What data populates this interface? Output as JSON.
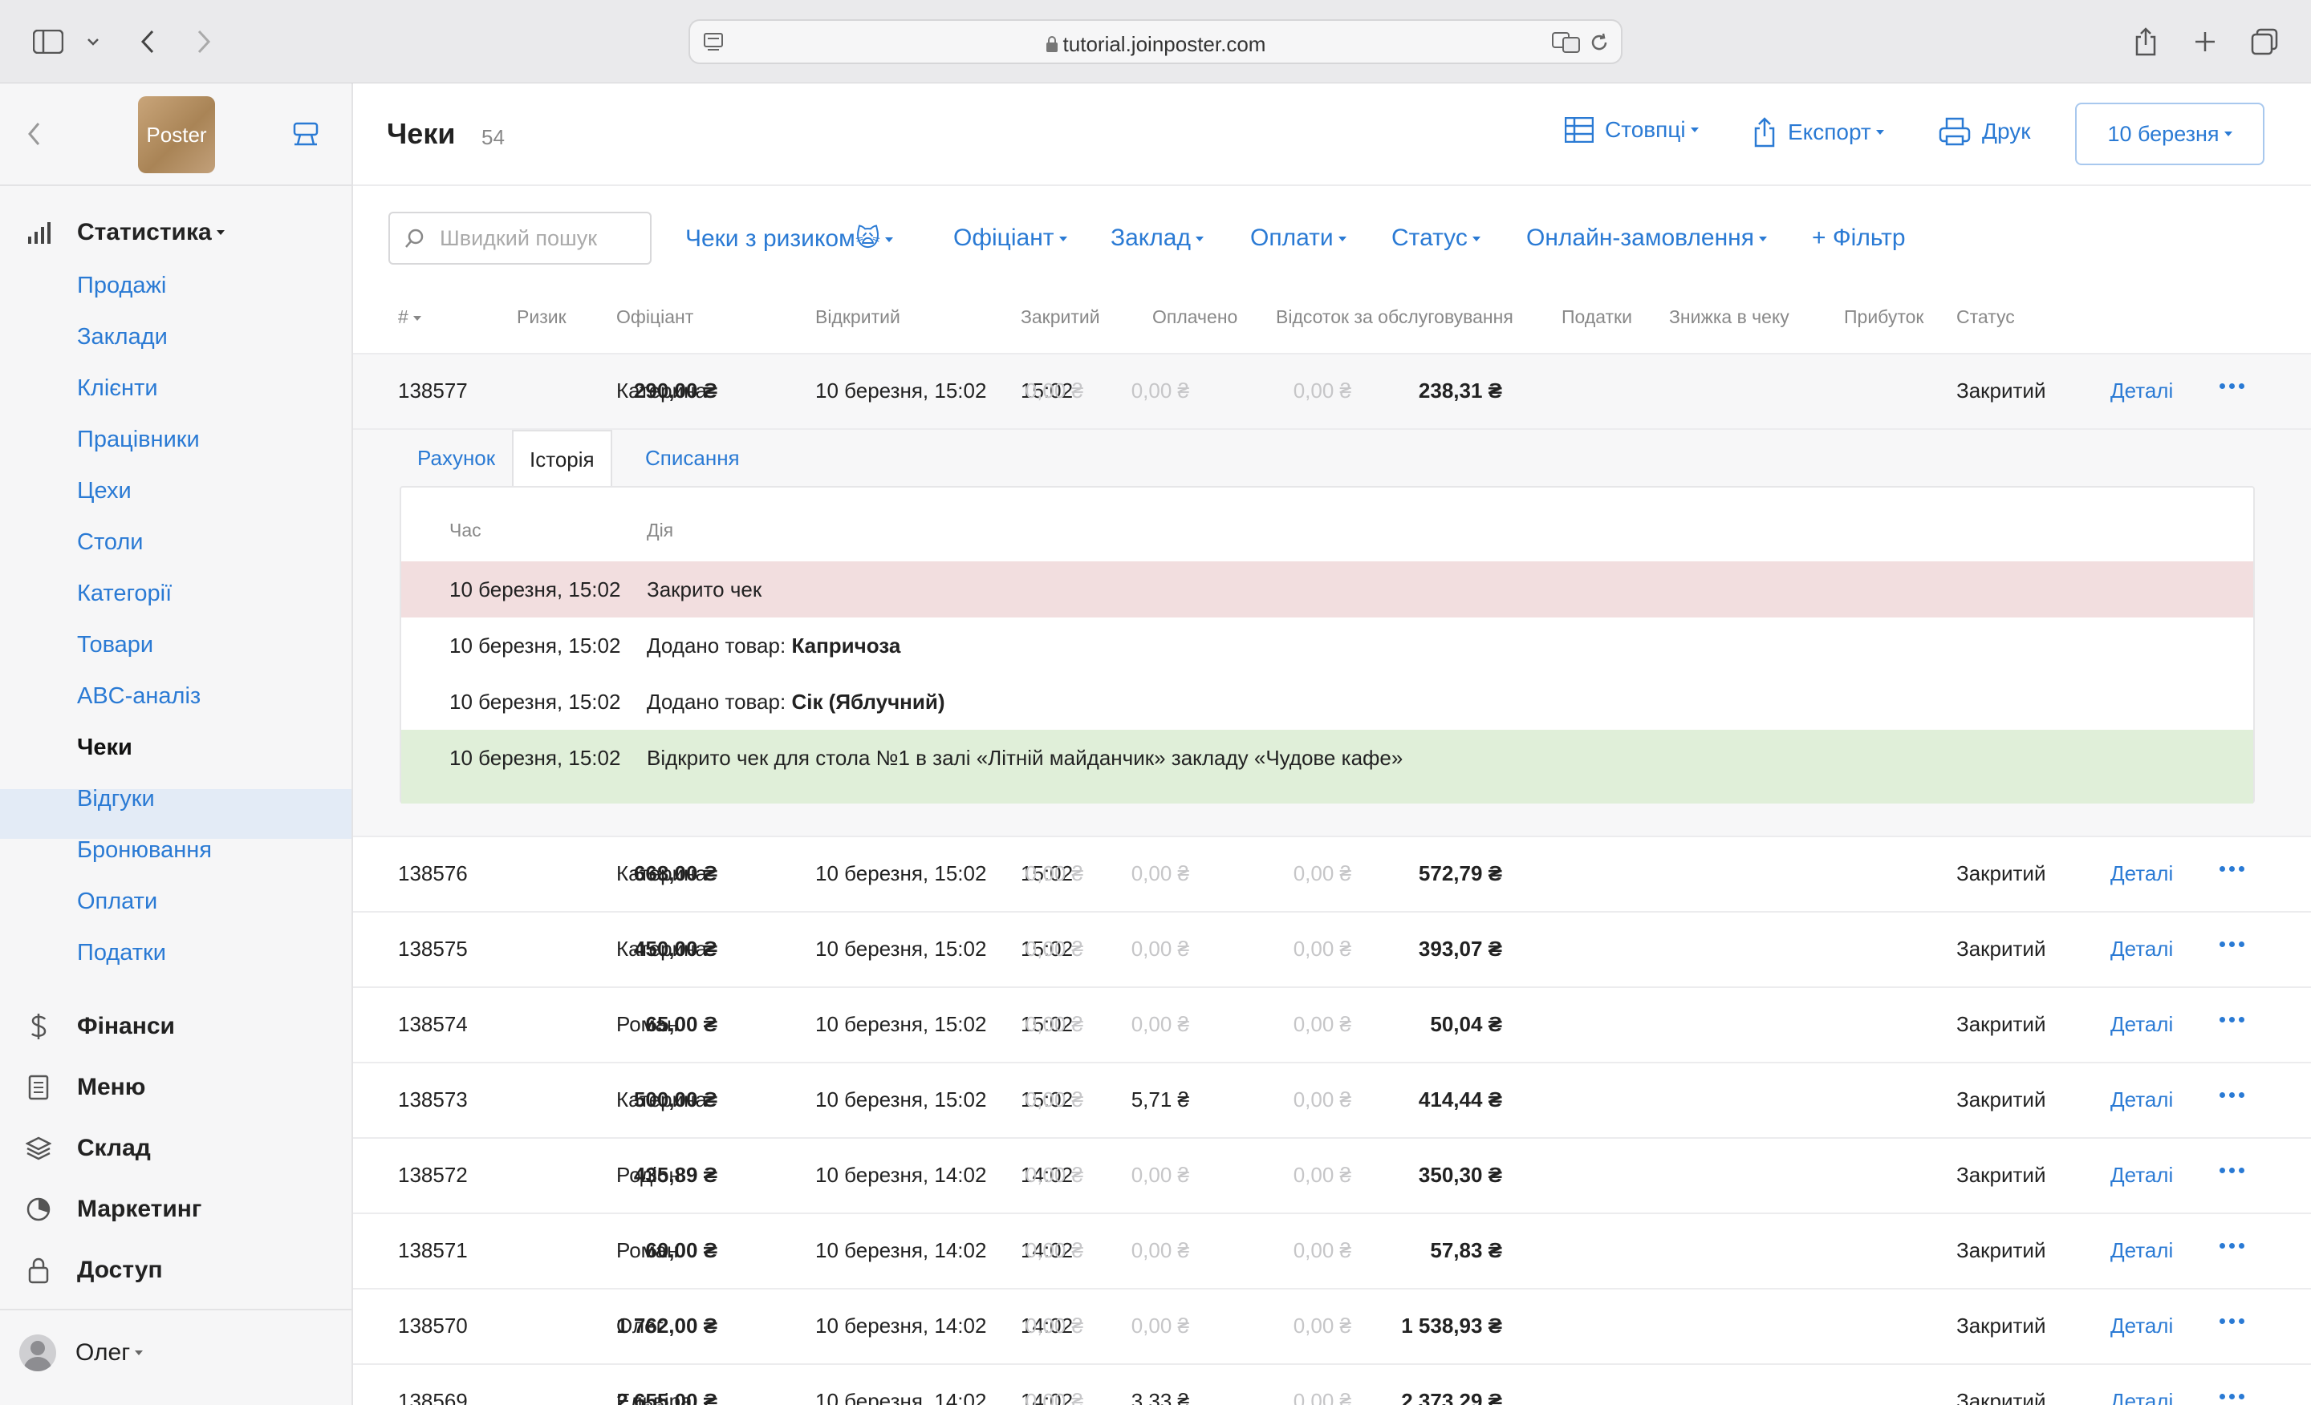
{
  "browser": {
    "url": "tutorial.joinposter.com"
  },
  "sidebar": {
    "logo_text": "Poster",
    "statistics_label": "Статистика",
    "items": [
      {
        "label": "Продажі"
      },
      {
        "label": "Заклади"
      },
      {
        "label": "Клієнти"
      },
      {
        "label": "Працівники"
      },
      {
        "label": "Цехи"
      },
      {
        "label": "Столи"
      },
      {
        "label": "Категорії"
      },
      {
        "label": "Товари"
      },
      {
        "label": "ABC-аналіз"
      },
      {
        "label": "Чеки"
      },
      {
        "label": "Відгуки"
      },
      {
        "label": "Бронювання"
      },
      {
        "label": "Оплати"
      },
      {
        "label": "Податки"
      }
    ],
    "active_item": "Чеки",
    "sections": [
      {
        "label": "Фінанси"
      },
      {
        "label": "Меню"
      },
      {
        "label": "Склад"
      },
      {
        "label": "Маркетинг"
      },
      {
        "label": "Доступ"
      }
    ],
    "user_name": "Олег"
  },
  "header": {
    "title": "Чеки",
    "count": "54",
    "columns_button": "Стовпці",
    "export_button": "Експорт",
    "print_button": "Друк",
    "date_button": "10 березня"
  },
  "filters": {
    "search_placeholder": "Швидкий пошук",
    "risk": "Чеки з ризиком",
    "risk_emoji": "🙀",
    "waiter": "Офіціант",
    "venue": "Заклад",
    "payments": "Оплати",
    "status": "Статус",
    "online": "Онлайн-замовлення",
    "add_filter": "+ Фільтр"
  },
  "table": {
    "headers": {
      "num": "#",
      "risk": "Ризик",
      "waiter": "Офіціант",
      "opened": "Відкритий",
      "closed": "Закритий",
      "paid": "Оплачено",
      "service": "Відсоток за обслуговування",
      "taxes": "Податки",
      "discount": "Знижка в чеку",
      "profit": "Прибуток",
      "status": "Статус"
    },
    "details_label": "Деталі",
    "rows": [
      {
        "id": "138577",
        "waiter": "Катерина",
        "opened": "10 березня, 15:02",
        "closed": "15:02",
        "paid": "290,00 ₴",
        "service": "0,00 ₴",
        "taxes": "0,00 ₴",
        "discount": "0,00 ₴",
        "profit": "238,31 ₴",
        "status": "Закритий"
      },
      {
        "id": "138576",
        "waiter": "Катерина",
        "opened": "10 березня, 15:02",
        "closed": "15:02",
        "paid": "668,00 ₴",
        "service": "0,00 ₴",
        "taxes": "0,00 ₴",
        "discount": "0,00 ₴",
        "profit": "572,79 ₴",
        "status": "Закритий"
      },
      {
        "id": "138575",
        "waiter": "Катерина",
        "opened": "10 березня, 15:02",
        "closed": "15:02",
        "paid": "450,00 ₴",
        "service": "0,00 ₴",
        "taxes": "0,00 ₴",
        "discount": "0,00 ₴",
        "profit": "393,07 ₴",
        "status": "Закритий"
      },
      {
        "id": "138574",
        "waiter": "Роман",
        "opened": "10 березня, 15:02",
        "closed": "15:02",
        "paid": "65,00 ₴",
        "service": "0,00 ₴",
        "taxes": "0,00 ₴",
        "discount": "0,00 ₴",
        "profit": "50,04 ₴",
        "status": "Закритий"
      },
      {
        "id": "138573",
        "waiter": "Катерина",
        "opened": "10 березня, 15:02",
        "closed": "15:02",
        "paid": "500,00 ₴",
        "service": "0,00 ₴",
        "taxes": "5,71 ₴",
        "discount": "0,00 ₴",
        "profit": "414,44 ₴",
        "status": "Закритий"
      },
      {
        "id": "138572",
        "waiter": "Родіон",
        "opened": "10 березня, 14:02",
        "closed": "14:02",
        "paid": "435,89 ₴",
        "service": "0,00 ₴",
        "taxes": "0,00 ₴",
        "discount": "0,00 ₴",
        "profit": "350,30 ₴",
        "status": "Закритий"
      },
      {
        "id": "138571",
        "waiter": "Роман",
        "opened": "10 березня, 14:02",
        "closed": "14:02",
        "paid": "60,00 ₴",
        "service": "0,00 ₴",
        "taxes": "0,00 ₴",
        "discount": "0,00 ₴",
        "profit": "57,83 ₴",
        "status": "Закритий"
      },
      {
        "id": "138570",
        "waiter": "Олег",
        "opened": "10 березня, 14:02",
        "closed": "14:02",
        "paid": "1 762,00 ₴",
        "service": "0,00 ₴",
        "taxes": "0,00 ₴",
        "discount": "0,00 ₴",
        "profit": "1 538,93 ₴",
        "status": "Закритий"
      },
      {
        "id": "138569",
        "waiter": "Ельвіра",
        "opened": "10 березня, 14:02",
        "closed": "14:02",
        "paid": "2 655,00 ₴",
        "service": "0,00 ₴",
        "taxes": "3,33 ₴",
        "discount": "0,00 ₴",
        "profit": "2 373,29 ₴",
        "status": "Закритий"
      }
    ]
  },
  "detail": {
    "tabs": [
      "Рахунок",
      "Історія",
      "Списання"
    ],
    "active_tab": "Історія",
    "history_headers": {
      "time": "Час",
      "action": "Дія"
    },
    "history": [
      {
        "time": "10 березня, 15:02",
        "action": "Закрито чек",
        "bold": ""
      },
      {
        "time": "10 березня, 15:02",
        "action": "Додано товар: ",
        "bold": "Капричоза"
      },
      {
        "time": "10 березня, 15:02",
        "action": "Додано товар: ",
        "bold": "Сік (Яблучний)"
      },
      {
        "time": "10 березня, 15:02",
        "action": "Відкрито чек для стола №1 в залі «Літній майданчик» закладу «Чудове кафе»",
        "bold": ""
      }
    ]
  },
  "colors": {
    "accent": "#2a7ad4",
    "closed_row": "#f2dedf",
    "opened_row": "#e0efd9"
  }
}
